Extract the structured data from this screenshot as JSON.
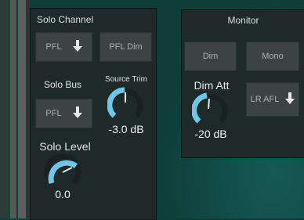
{
  "solo_channel": {
    "title": "Solo Channel",
    "pfl_label": "PFL",
    "pfl_dim_label": "PFL Dim",
    "solo_bus_label": "Solo Bus",
    "solo_bus_value": "PFL",
    "source_trim_label": "Source Trim",
    "source_trim_value": "-3.0 dB",
    "solo_level_label": "Solo Level",
    "solo_level_value": "0.0"
  },
  "monitor": {
    "title": "Monitor",
    "dim_label": "Dim",
    "mono_label": "Mono",
    "dim_att_label": "Dim Att",
    "dim_att_value": "-20 dB",
    "lr_afl_label": "LR AFL"
  },
  "icons": {
    "dropdown": "down-arrow-icon",
    "knob": "rotary-knob-icon"
  },
  "colors": {
    "knob_accent": "#6fc6e8",
    "background": "#0f3d3a",
    "panel": "#1e2a2a",
    "button": "#3b4343"
  }
}
